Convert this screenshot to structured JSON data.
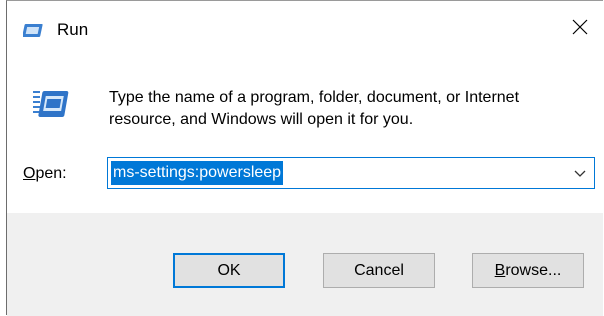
{
  "window": {
    "title": "Run",
    "icon": "run-icon",
    "close_icon": "close-icon"
  },
  "dialog": {
    "description": "Type the name of a program, folder, document, or Internet resource, and Windows will open it for you.",
    "open_label_underlined": "O",
    "open_label_rest": "pen:",
    "input_value": "ms-settings:powersleep",
    "dropdown_icon": "chevron-down-icon"
  },
  "buttons": {
    "ok": "OK",
    "cancel": "Cancel",
    "browse_underlined": "B",
    "browse_rest": "rowse..."
  },
  "colors": {
    "accent": "#0078d7",
    "footer_bg": "#f0f0f0",
    "button_bg": "#e1e1e1"
  }
}
